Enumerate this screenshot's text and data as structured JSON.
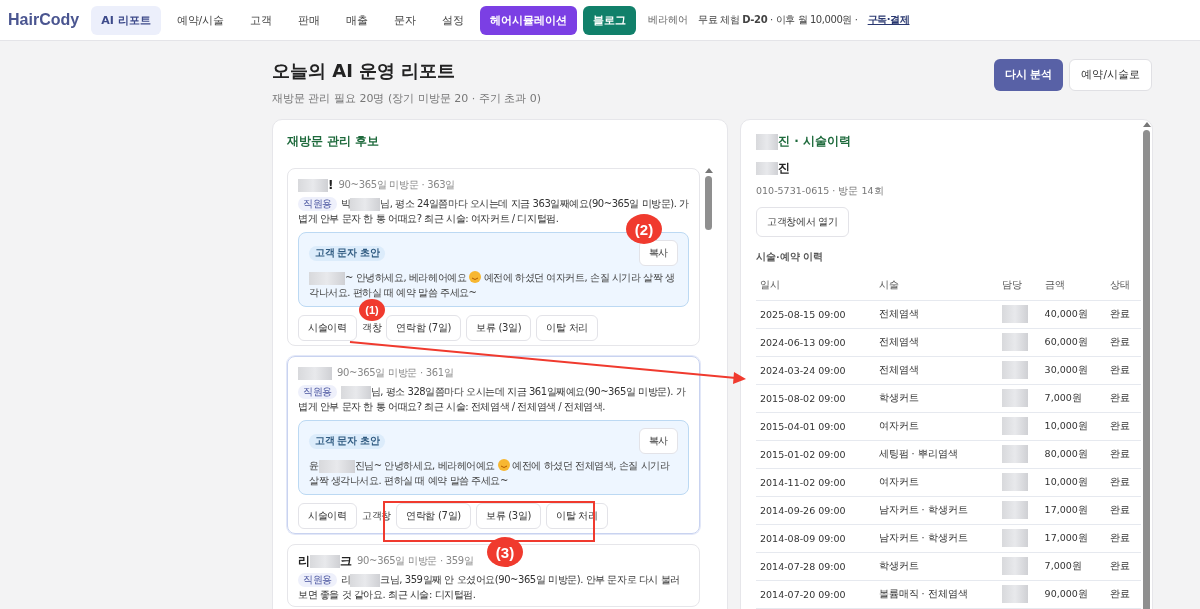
{
  "nav": {
    "logo": "HairCody",
    "items": [
      {
        "label": "AI 리포트",
        "kind": "tab",
        "selected": true
      },
      {
        "label": "예약/시술",
        "kind": "tab",
        "selected": false
      },
      {
        "label": "고객",
        "kind": "tab",
        "selected": false
      },
      {
        "label": "판매",
        "kind": "tab",
        "selected": false
      },
      {
        "label": "매출",
        "kind": "tab",
        "selected": false
      },
      {
        "label": "문자",
        "kind": "tab",
        "selected": false
      },
      {
        "label": "설정",
        "kind": "tab",
        "selected": false
      },
      {
        "label": "헤어시뮬레이션",
        "kind": "purple",
        "selected": false
      },
      {
        "label": "블로그",
        "kind": "teal",
        "selected": false
      }
    ],
    "shop": "베라헤어",
    "trial": "무료 체험 **D-20** · 이후 월 10,000원 ·",
    "subscribe": "구독·결제"
  },
  "header": {
    "title": "오늘의 AI 운영 리포트",
    "subtitle": "재방문 관리 필요 20명 (장기 미방문 20 · 주기 초과 0)",
    "buttons": [
      {
        "label": "다시 분석",
        "kind": "primary"
      },
      {
        "label": "예약/시술로",
        "kind": "plain"
      }
    ]
  },
  "candidates": {
    "title": "재방문 관리 후보",
    "cards": [
      {
        "name": [
          {
            "kind": "blur"
          },
          {
            "kind": "text",
            "t": "!"
          }
        ],
        "meta": "90~365일 미방문 · 363일",
        "highlighted": false,
        "badge": "직원용",
        "message": [
          {
            "kind": "text",
            "t": "빅"
          },
          {
            "kind": "blur"
          },
          {
            "kind": "text",
            "t": "님, 평소 24일쯤마다 오시는데 지금 363일째예요(90~365일 미방문). 가볍게 안부 문자 한 통 어때요? 최근 시술: 여자커트 / 디지털펌."
          }
        ],
        "draft_label": "고객 문자 초안",
        "copy": "복사",
        "draft": [
          {
            "kind": "blur"
          },
          {
            "kind": "text",
            "t": "~ 안녕하세요, 베라헤어예요 "
          },
          {
            "kind": "emoji"
          },
          {
            "kind": "text",
            "t": " 예전에 하셨던 여자커트, 손질 시기라 살짝 생각나서요. 편하실 때 예약 말씀 주세요~"
          }
        ],
        "actions": [
          {
            "label": "시술이력",
            "kind": "button"
          },
          {
            "label": "객창",
            "kind": "link"
          },
          {
            "label": "연락함 (7일)",
            "kind": "button"
          },
          {
            "label": "보류 (3일)",
            "kind": "button"
          },
          {
            "label": "이탈 처리",
            "kind": "button"
          }
        ]
      },
      {
        "name": [
          {
            "kind": "blur"
          }
        ],
        "meta": "90~365일 미방문 · 361일",
        "highlighted": true,
        "badge": "직원용",
        "message": [
          {
            "kind": "blur"
          },
          {
            "kind": "text",
            "t": "님, 평소 328일쯤마다 오시는데 지금 361일째예요(90~365일 미방문). 가볍게 안부 문자 한 통 어때요? 최근 시술: 전체염색 / 전체염색 / 전체염색."
          }
        ],
        "draft_label": "고객 문자 초안",
        "copy": "복사",
        "draft": [
          {
            "kind": "text",
            "t": "윤"
          },
          {
            "kind": "blur"
          },
          {
            "kind": "text",
            "t": "진님~ 안녕하세요, 베라헤어예요 "
          },
          {
            "kind": "emoji"
          },
          {
            "kind": "text",
            "t": " 예전에 하셨던 전체염색, 손질 시기라 살짝 생각나서요. 편하실 때 예약 말씀 주세요~"
          }
        ],
        "actions": [
          {
            "label": "시술이력",
            "kind": "button"
          },
          {
            "label": "고객창",
            "kind": "link"
          },
          {
            "label": "연락함 (7일)",
            "kind": "button"
          },
          {
            "label": "보류 (3일)",
            "kind": "button"
          },
          {
            "label": "이탈 처리",
            "kind": "button"
          }
        ]
      },
      {
        "name": [
          {
            "kind": "text",
            "t": "리"
          },
          {
            "kind": "blur"
          },
          {
            "kind": "text",
            "t": "크"
          }
        ],
        "meta": "90~365일 미방문 · 359일",
        "highlighted": false,
        "badge": "직원용",
        "message": [
          {
            "kind": "text",
            "t": "리"
          },
          {
            "kind": "blur"
          },
          {
            "kind": "text",
            "t": "크님, 359일째 안 오셨어요(90~365일 미방문). 안부 문자로 다시 불러보면 좋을 것 같아요. 최근 시술: 디지털펌."
          }
        ]
      }
    ]
  },
  "history": {
    "title": "진 · 시술이력",
    "name": "진",
    "info": "010-5731-0615 · 방문 14회",
    "open_button": "고객창에서 열기",
    "section": "시술·예약 이력",
    "columns": [
      "일시",
      "시술",
      "담당",
      "금액",
      "상태"
    ],
    "rows": [
      {
        "date": "2025-08-15 09:00",
        "service": "전체염색",
        "amount": "40,000원",
        "status": "완료"
      },
      {
        "date": "2024-06-13 09:00",
        "service": "전체염색",
        "amount": "60,000원",
        "status": "완료"
      },
      {
        "date": "2024-03-24 09:00",
        "service": "전체염색",
        "amount": "30,000원",
        "status": "완료"
      },
      {
        "date": "2015-08-02 09:00",
        "service": "학생커트",
        "amount": "7,000원",
        "status": "완료"
      },
      {
        "date": "2015-04-01 09:00",
        "service": "여자커트",
        "amount": "10,000원",
        "status": "완료"
      },
      {
        "date": "2015-01-02 09:00",
        "service": "세팅펌 · 뿌리염색",
        "amount": "80,000원",
        "status": "완료"
      },
      {
        "date": "2014-11-02 09:00",
        "service": "여자커트",
        "amount": "10,000원",
        "status": "완료"
      },
      {
        "date": "2014-09-26 09:00",
        "service": "남자커트 · 학생커트",
        "amount": "17,000원",
        "status": "완료"
      },
      {
        "date": "2014-08-09 09:00",
        "service": "남자커트 · 학생커트",
        "amount": "17,000원",
        "status": "완료"
      },
      {
        "date": "2014-07-28 09:00",
        "service": "학생커트",
        "amount": "7,000원",
        "status": "완료"
      },
      {
        "date": "2014-07-20 09:00",
        "service": "볼륨매직 · 전체염색",
        "amount": "90,000원",
        "status": "완료"
      }
    ]
  },
  "annotations": [
    "(1)",
    "(2)",
    "(3)"
  ]
}
